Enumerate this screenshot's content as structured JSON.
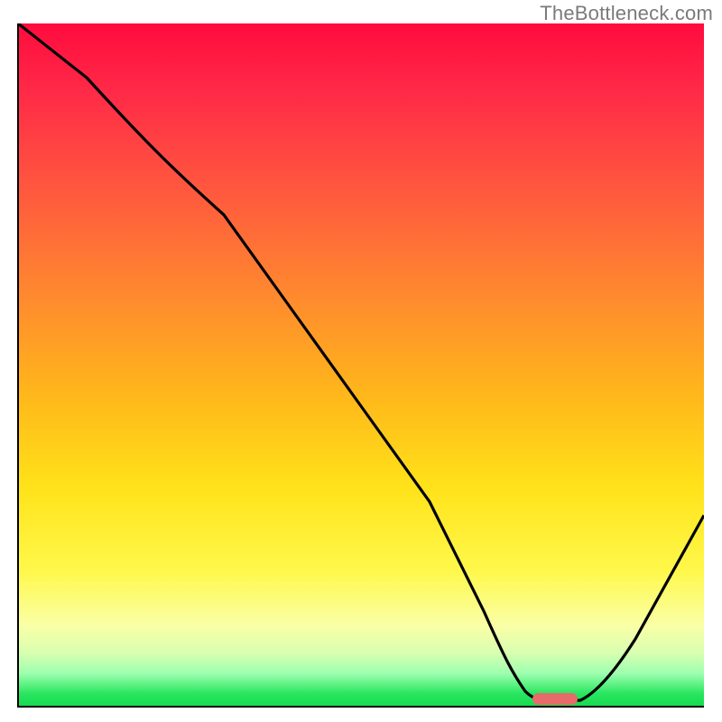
{
  "watermark": "TheBottleneck.com",
  "chart_data": {
    "type": "line",
    "title": "",
    "xlabel": "",
    "ylabel": "",
    "xlim": [
      0,
      100
    ],
    "ylim": [
      0,
      100
    ],
    "grid": false,
    "series": [
      {
        "name": "bottleneck-curve",
        "x": [
          0,
          10,
          22,
          30,
          40,
          50,
          60,
          68,
          72,
          78,
          82,
          90,
          100
        ],
        "values": [
          100,
          92,
          80,
          72,
          58,
          44,
          30,
          14,
          4,
          1,
          1,
          10,
          28
        ]
      }
    ],
    "gradient_stops": [
      {
        "pos": 0,
        "color": "#ff0b3e"
      },
      {
        "pos": 25,
        "color": "#ff5a3e"
      },
      {
        "pos": 55,
        "color": "#ffb91a"
      },
      {
        "pos": 80,
        "color": "#fff84b"
      },
      {
        "pos": 95,
        "color": "#9effb0"
      },
      {
        "pos": 100,
        "color": "#16d94e"
      }
    ],
    "marker": {
      "x_start": 75,
      "x_end": 82,
      "y": 1,
      "color": "#e86a6a"
    }
  }
}
